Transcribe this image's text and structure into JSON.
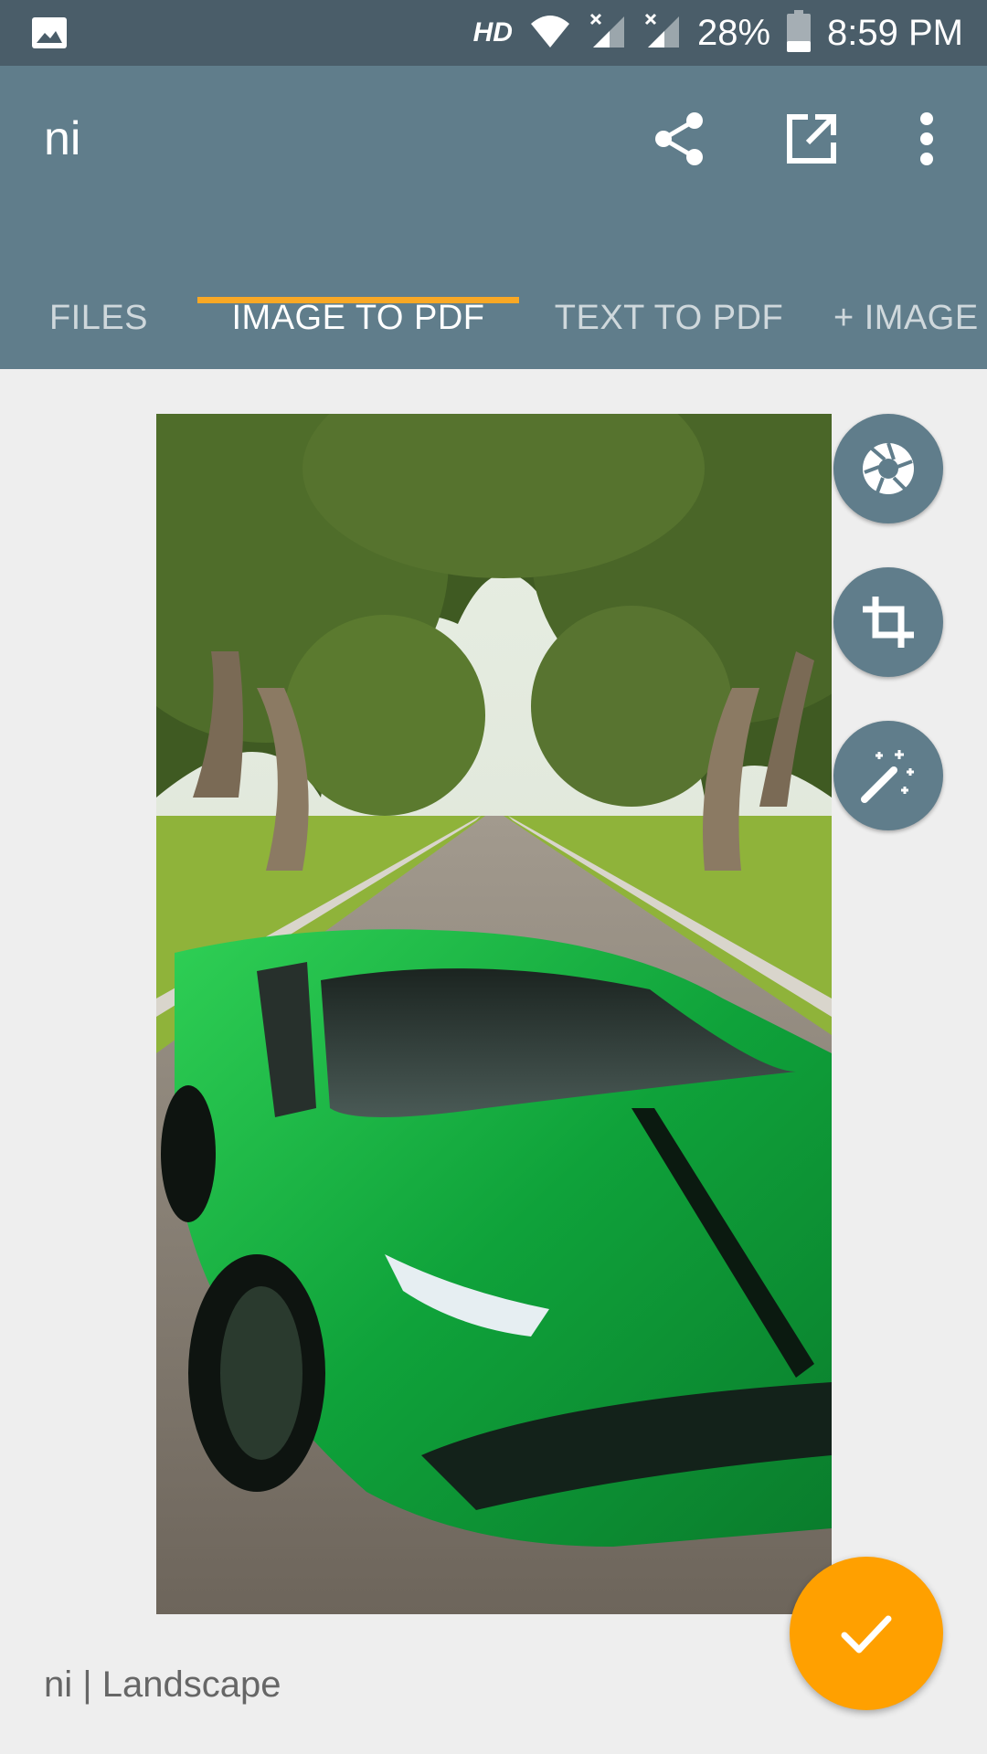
{
  "status_bar": {
    "network_label": "HD",
    "battery": "28%",
    "time": "8:59 PM",
    "icons": [
      "image-notification-icon",
      "wifi-icon",
      "signal-icon",
      "signal-icon",
      "battery-icon"
    ]
  },
  "app_bar": {
    "title": "ni",
    "actions": [
      "share-icon",
      "open-external-icon",
      "more-vert-icon"
    ]
  },
  "tabs": [
    {
      "label": "FILES",
      "active": false
    },
    {
      "label": "IMAGE TO PDF",
      "active": true
    },
    {
      "label": "TEXT TO PDF",
      "active": false
    },
    {
      "label": "+ IMAGE",
      "active": false
    }
  ],
  "image_tools": [
    "aperture-icon",
    "crop-icon",
    "magic-wand-icon"
  ],
  "fab": {
    "icon": "check-icon"
  },
  "caption": "ni | Landscape",
  "colors": {
    "status_bar": "#4a5d69",
    "app_bar": "#607d8b",
    "tab_indicator": "#f9a825",
    "fab": "#ffa000",
    "background": "#eeeeee"
  }
}
